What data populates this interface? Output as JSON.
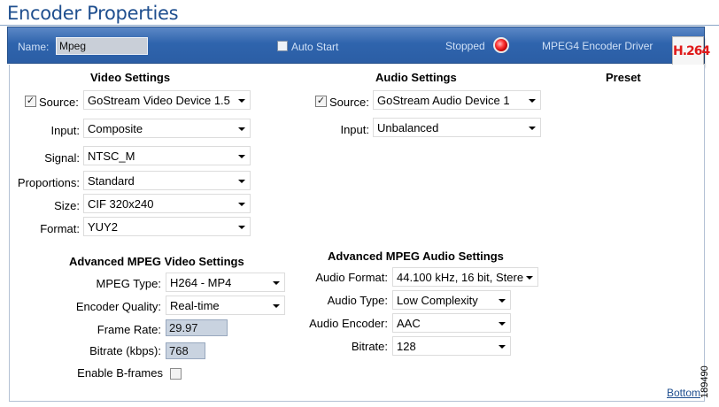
{
  "page": {
    "title": "Encoder Properties",
    "bottom_link": "Bottom",
    "figure_id": "189490"
  },
  "header": {
    "name_label": "Name:",
    "name_value": "Mpeg",
    "auto_start_label": "Auto Start",
    "auto_start_checked": false,
    "status_label": "Stopped",
    "status_color": "#ff2a2a",
    "driver_label": "MPEG4 Encoder Driver",
    "logo_text": "H.264",
    "banner_color": "#2f64ad"
  },
  "video": {
    "heading": "Video Settings",
    "source": {
      "label": "Source:",
      "checked": true,
      "value": "GoStream Video Device 1.5"
    },
    "input": {
      "label": "Input:",
      "value": "Composite"
    },
    "signal": {
      "label": "Signal:",
      "value": "NTSC_M"
    },
    "proportions": {
      "label": "Proportions:",
      "value": "Standard"
    },
    "size": {
      "label": "Size:",
      "value": "CIF 320x240"
    },
    "format": {
      "label": "Format:",
      "value": "YUY2"
    }
  },
  "audio": {
    "heading": "Audio Settings",
    "source": {
      "label": "Source:",
      "checked": true,
      "value": "GoStream Audio Device 1"
    },
    "input": {
      "label": "Input:",
      "value": "Unbalanced"
    }
  },
  "preset": {
    "heading": "Preset"
  },
  "adv_video": {
    "heading": "Advanced MPEG Video Settings",
    "mpeg_type": {
      "label": "MPEG Type:",
      "value": "H264 - MP4"
    },
    "encoder_quality": {
      "label": "Encoder Quality:",
      "value": "Real-time"
    },
    "frame_rate": {
      "label": "Frame Rate:",
      "value": "29.97"
    },
    "bitrate": {
      "label": "Bitrate (kbps):",
      "value": "768"
    },
    "b_frames": {
      "label": "Enable B-frames",
      "checked": false
    }
  },
  "adv_audio": {
    "heading": "Advanced MPEG Audio Settings",
    "format": {
      "label": "Audio Format:",
      "value": "44.100 kHz, 16 bit, Stere"
    },
    "type": {
      "label": "Audio Type:",
      "value": "Low Complexity"
    },
    "encoder": {
      "label": "Audio Encoder:",
      "value": "AAC"
    },
    "bitrate": {
      "label": "Bitrate:",
      "value": "128"
    }
  }
}
